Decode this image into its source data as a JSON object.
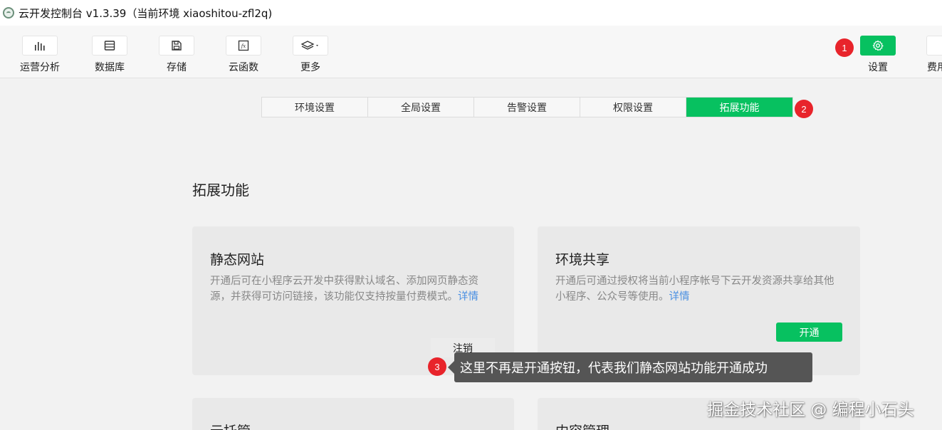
{
  "window": {
    "title": "云开发控制台 v1.3.39（当前环境 xiaoshitou-zfl2q)"
  },
  "toolbar": {
    "items": [
      {
        "label": "运营分析",
        "icon": "bar-chart-icon"
      },
      {
        "label": "数据库",
        "icon": "database-icon"
      },
      {
        "label": "存储",
        "icon": "save-icon"
      },
      {
        "label": "云函数",
        "icon": "function-icon"
      },
      {
        "label": "更多",
        "icon": "layers-icon"
      }
    ],
    "settings_label": "设置",
    "partial_label": "费用"
  },
  "annotations": {
    "badge1": "1",
    "badge2": "2",
    "badge3": "3",
    "tooltip": "这里不再是开通按钮，代表我们静态网站功能开通成功"
  },
  "tabs": [
    {
      "label": "环境设置",
      "active": false
    },
    {
      "label": "全局设置",
      "active": false
    },
    {
      "label": "告警设置",
      "active": false
    },
    {
      "label": "权限设置",
      "active": false
    },
    {
      "label": "拓展功能",
      "active": true
    }
  ],
  "main": {
    "section_title": "拓展功能",
    "cards": [
      {
        "title": "静态网站",
        "desc": "开通后可在小程序云开发中获得默认域名、添加网页静态资源，并获得可访问链接，该功能仅支持按量付费模式。",
        "link": "详情",
        "button": "注销"
      },
      {
        "title": "环境共享",
        "desc": "开通后可通过授权将当前小程序帐号下云开发资源共享给其他小程序、公众号等使用。",
        "link": "详情",
        "button": "开通"
      },
      {
        "title": "云托管"
      },
      {
        "title": "内容管理"
      }
    ]
  },
  "watermark": "掘金技术社区 @ 编程小石头",
  "colors": {
    "accent": "#07c160",
    "badge": "#e8242b",
    "link": "#4a90e2",
    "tooltip_bg": "#555555"
  }
}
